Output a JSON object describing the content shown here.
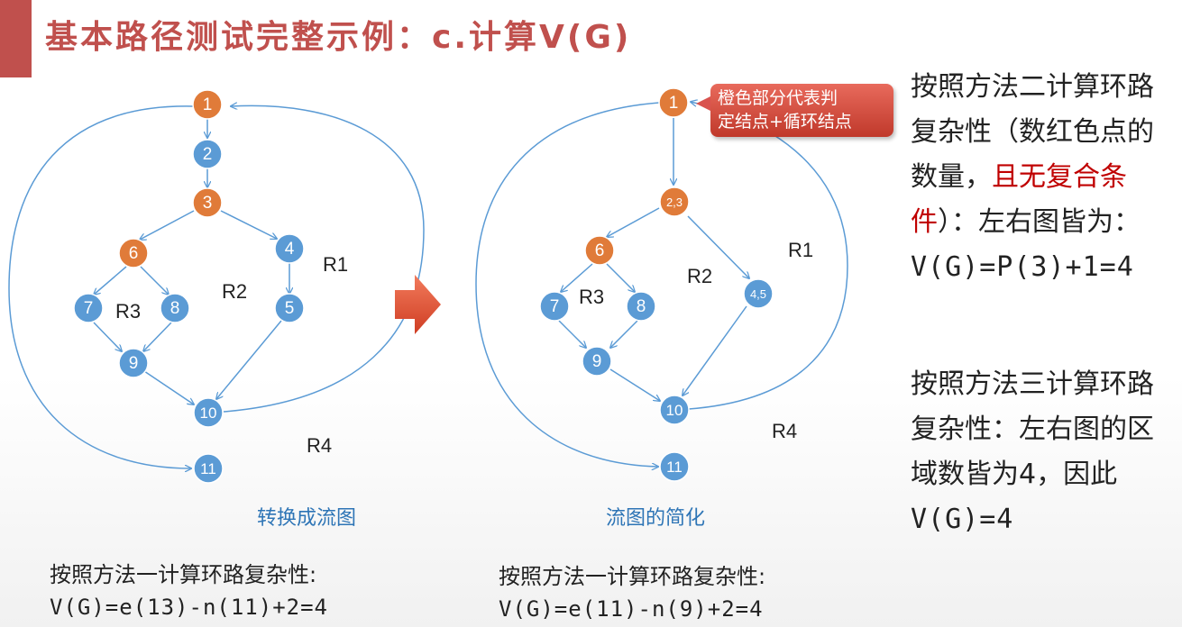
{
  "title": "基本路径测试完整示例：c.计算V(G)",
  "left_graph": {
    "caption": "转换成流图",
    "nodes": [
      {
        "id": "1",
        "label": "1",
        "type": "decision"
      },
      {
        "id": "2",
        "label": "2",
        "type": "normal"
      },
      {
        "id": "3",
        "label": "3",
        "type": "decision"
      },
      {
        "id": "4",
        "label": "4",
        "type": "normal"
      },
      {
        "id": "5",
        "label": "5",
        "type": "normal"
      },
      {
        "id": "6",
        "label": "6",
        "type": "decision"
      },
      {
        "id": "7",
        "label": "7",
        "type": "normal"
      },
      {
        "id": "8",
        "label": "8",
        "type": "normal"
      },
      {
        "id": "9",
        "label": "9",
        "type": "normal"
      },
      {
        "id": "10",
        "label": "10",
        "type": "normal"
      },
      {
        "id": "11",
        "label": "11",
        "type": "normal"
      }
    ],
    "regions": [
      "R1",
      "R2",
      "R3",
      "R4"
    ],
    "formula_label": "按照方法一计算环路复杂性:",
    "formula": "V(G)=e(13)-n(11)+2=4"
  },
  "right_graph": {
    "caption": "流图的简化",
    "nodes": [
      {
        "id": "1",
        "label": "1",
        "type": "decision"
      },
      {
        "id": "23",
        "label": "2,3",
        "type": "decision"
      },
      {
        "id": "6",
        "label": "6",
        "type": "decision"
      },
      {
        "id": "45",
        "label": "4,5",
        "type": "normal"
      },
      {
        "id": "7",
        "label": "7",
        "type": "normal"
      },
      {
        "id": "8",
        "label": "8",
        "type": "normal"
      },
      {
        "id": "9",
        "label": "9",
        "type": "normal"
      },
      {
        "id": "10",
        "label": "10",
        "type": "normal"
      },
      {
        "id": "11",
        "label": "11",
        "type": "normal"
      }
    ],
    "regions": [
      "R1",
      "R2",
      "R3",
      "R4"
    ],
    "formula_label": "按照方法一计算环路复杂性:",
    "formula": "V(G)=e(11)-n(9)+2=4"
  },
  "callout": {
    "line1": "橙色部分代表判",
    "line2": "定结点+循环结点"
  },
  "method2": {
    "part1": "按照方法二计算环路复杂性（数红色点的数量，",
    "highlight": "且无复合条件",
    "part2": "）：左右图皆为：",
    "formula": "V(G)=P(3)+1=4"
  },
  "method3": {
    "text": "按照方法三计算环路复杂性：左右图的区域数皆为4，因此",
    "formula": "V(G)=4"
  },
  "colors": {
    "decision": "#e07b39",
    "normal": "#5b9bd5",
    "edge": "#5b9bd5",
    "title": "#c0504d",
    "arrow": "#e0553a"
  }
}
